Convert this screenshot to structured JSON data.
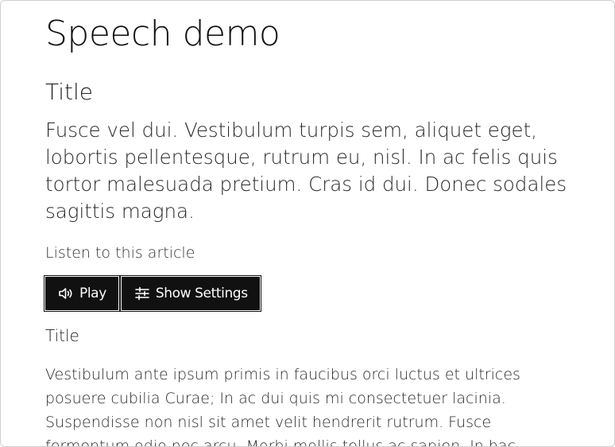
{
  "page": {
    "heading": "Speech demo"
  },
  "article": {
    "title": "Title",
    "lede": "Fusce vel dui. Vestibulum turpis sem, aliquet eget, lobortis pellentesque, rutrum eu, nisl. In ac felis quis tortor malesuada pretium. Cras id dui. Donec sodales sagittis magna."
  },
  "player": {
    "listen_label": "Listen to this article",
    "play_label": "Play",
    "play_icon": "speaker-icon",
    "settings_label": "Show Settings",
    "settings_icon": "sliders-icon"
  },
  "section": {
    "title": "Title",
    "body": "Vestibulum ante ipsum primis in faucibus orci luctus et ultrices posuere cubilia Curae; In ac dui quis mi consectetuer lacinia. Suspendisse non nisl sit amet velit hendrerit rutrum. Fusce fermentum odio nec arcu. Morbi mollis tellus ac sapien. In hac"
  },
  "colors": {
    "button_bg": "#111111",
    "button_text": "#ffffff",
    "text": "#1a1a1a"
  }
}
